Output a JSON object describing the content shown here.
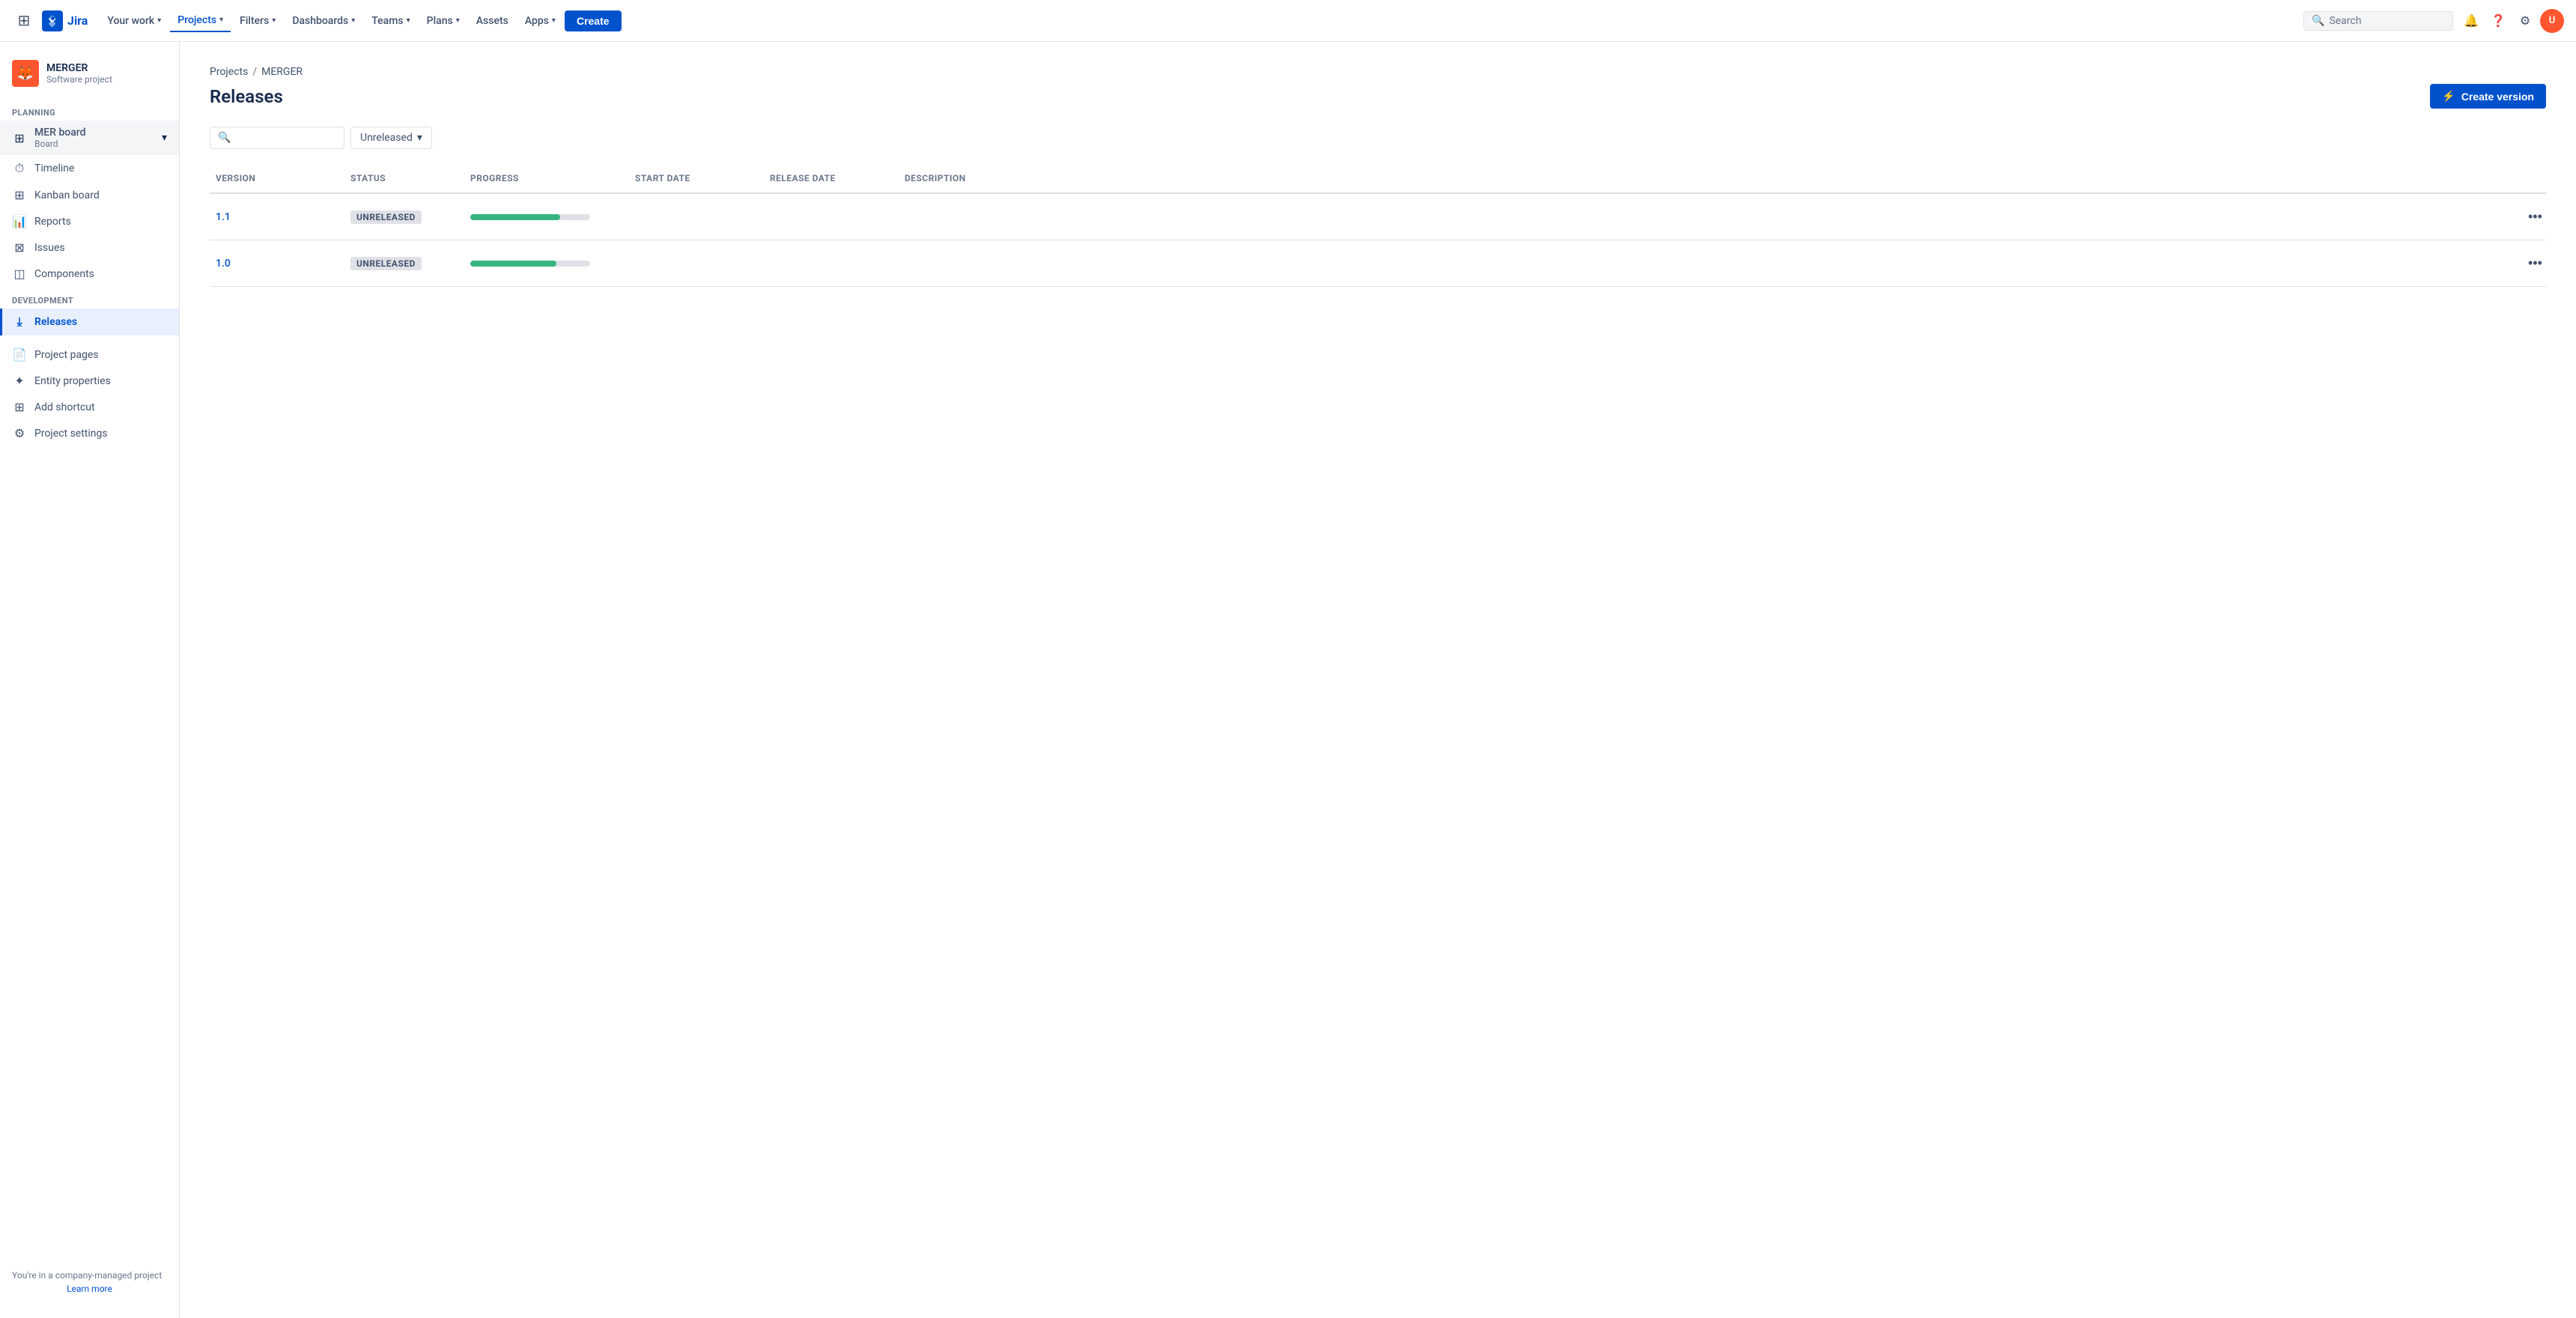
{
  "app": {
    "name": "Jira",
    "logo_text": "Jira"
  },
  "topnav": {
    "your_work": "Your work",
    "projects": "Projects",
    "filters": "Filters",
    "dashboards": "Dashboards",
    "teams": "Teams",
    "plans": "Plans",
    "assets": "Assets",
    "apps": "Apps",
    "create": "Create",
    "search_placeholder": "Search"
  },
  "sidebar": {
    "project_name": "MERGER",
    "project_type": "Software project",
    "project_icon": "🦊",
    "planning_label": "PLANNING",
    "board_name": "MER board",
    "board_type": "Board",
    "nav_items": [
      {
        "id": "timeline",
        "label": "Timeline",
        "icon": "⏱"
      },
      {
        "id": "kanban",
        "label": "Kanban board",
        "icon": "⊞"
      },
      {
        "id": "reports",
        "label": "Reports",
        "icon": "📊"
      },
      {
        "id": "issues",
        "label": "Issues",
        "icon": "⊠"
      },
      {
        "id": "components",
        "label": "Components",
        "icon": "◫"
      }
    ],
    "development_label": "DEVELOPMENT",
    "dev_items": [
      {
        "id": "releases",
        "label": "Releases",
        "icon": "⤓",
        "active": true
      }
    ],
    "other_items": [
      {
        "id": "project-pages",
        "label": "Project pages",
        "icon": "📄"
      },
      {
        "id": "entity-properties",
        "label": "Entity properties",
        "icon": "✦"
      },
      {
        "id": "add-shortcut",
        "label": "Add shortcut",
        "icon": "⊞"
      },
      {
        "id": "project-settings",
        "label": "Project settings",
        "icon": "⚙"
      }
    ],
    "company_text": "You're in a company-managed project",
    "learn_more": "Learn more"
  },
  "breadcrumb": {
    "projects": "Projects",
    "project": "MERGER"
  },
  "page": {
    "title": "Releases",
    "create_version_label": "Create version"
  },
  "filters": {
    "search_placeholder": "",
    "status_filter": "Unreleased"
  },
  "table": {
    "columns": [
      "Version",
      "Status",
      "Progress",
      "Start date",
      "Release date",
      "Description"
    ],
    "rows": [
      {
        "version": "1.1",
        "status": "UNRELEASED",
        "progress_pct": 75,
        "start_date": "",
        "release_date": "",
        "description": ""
      },
      {
        "version": "1.0",
        "status": "UNRELEASED",
        "progress_pct": 72,
        "start_date": "",
        "release_date": "",
        "description": ""
      }
    ]
  },
  "colors": {
    "accent": "#0052cc",
    "progress": "#36b37e",
    "unreleased_bg": "#dfe1e6",
    "unreleased_text": "#42526e"
  }
}
